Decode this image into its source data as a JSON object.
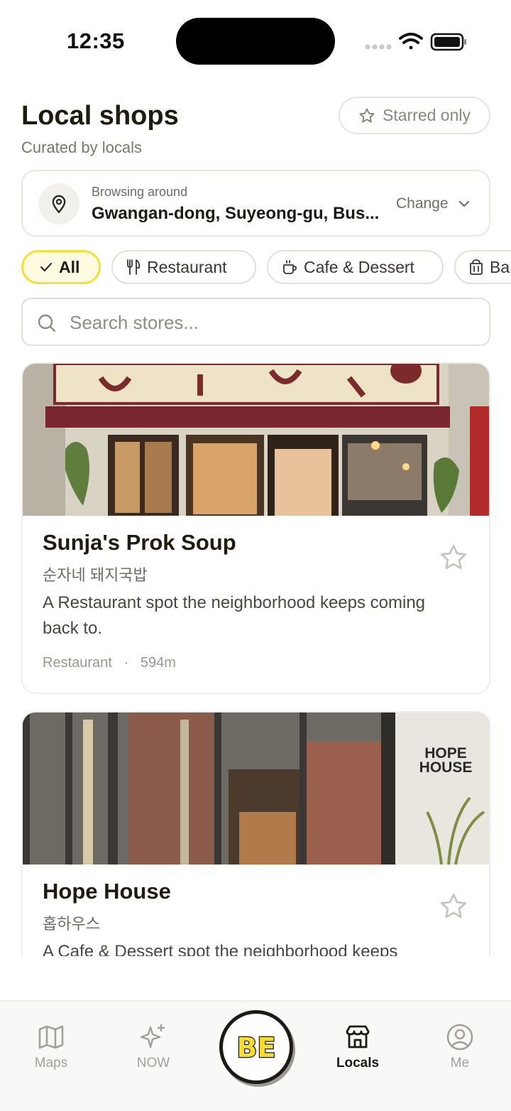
{
  "status_bar": {
    "time": "12:35"
  },
  "header": {
    "title": "Local shops",
    "subtitle": "Curated by locals",
    "starred_label": "Starred only"
  },
  "location": {
    "label": "Browsing around",
    "value": "Gwangan-dong, Suyeong-gu, Bus...",
    "change_label": "Change"
  },
  "filters": [
    {
      "label": "All",
      "icon": "check-icon",
      "active": true
    },
    {
      "label": "Restaurant",
      "icon": "fork-knife-icon",
      "active": false
    },
    {
      "label": "Cafe & Dessert",
      "icon": "coffee-cup-icon",
      "active": false
    },
    {
      "label": "Ba",
      "icon": "bakery-icon",
      "active": false
    }
  ],
  "search": {
    "placeholder": "Search stores..."
  },
  "stores": [
    {
      "name": "Sunja's Prok Soup",
      "korean_name": "순자네 돼지국밥",
      "description": "A Restaurant spot the neighborhood keeps coming back to.",
      "category": "Restaurant",
      "distance": "594m",
      "starred": false
    },
    {
      "name": "Hope House",
      "korean_name": "홉하우스",
      "description": "A Cafe & Dessert spot the neighborhood keeps",
      "sign_text_1": "HOPE",
      "sign_text_2": "HOUSE",
      "starred": false
    }
  ],
  "bottom_nav": {
    "items": [
      {
        "label": "Maps",
        "icon": "map-icon",
        "active": false
      },
      {
        "label": "NOW",
        "icon": "sparkle-icon",
        "active": false
      },
      {
        "label": "Locals",
        "icon": "store-icon",
        "active": true
      },
      {
        "label": "Me",
        "icon": "profile-icon",
        "active": false
      }
    ],
    "center_logo": "BE"
  },
  "colors": {
    "accent_yellow": "#f5df3b",
    "chip_active_bg": "#fffbe0",
    "text_primary": "#1c1a14",
    "text_secondary": "#6f6c66"
  }
}
